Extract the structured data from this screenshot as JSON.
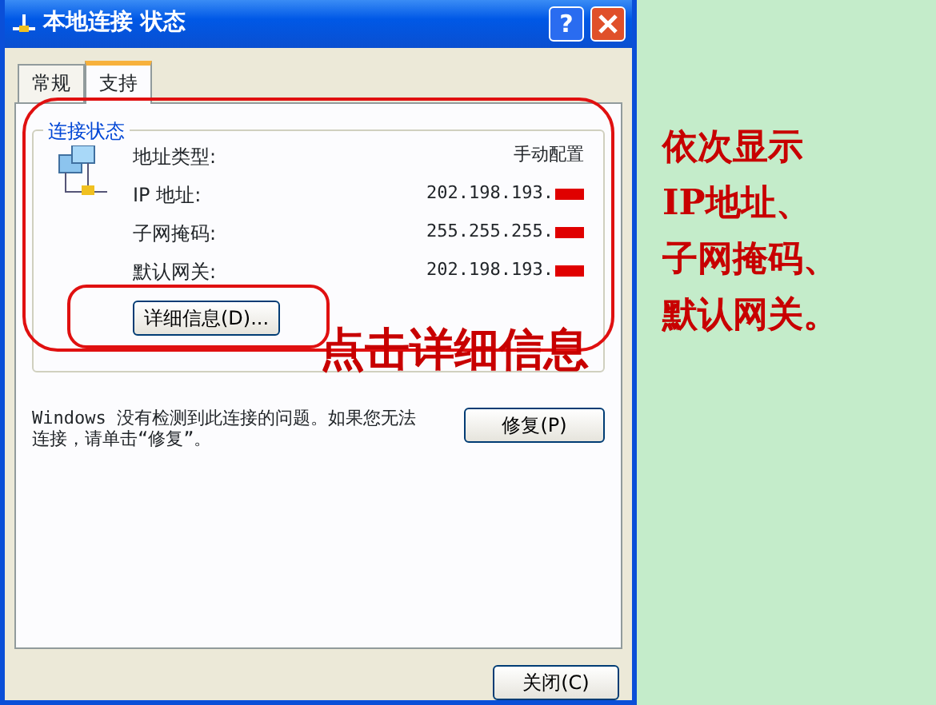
{
  "window": {
    "title": "本地连接 状态",
    "help_button": "?"
  },
  "tabs": [
    {
      "label": "常规",
      "selected": false
    },
    {
      "label": "支持",
      "selected": true
    }
  ],
  "connection_status": {
    "title": "连接状态",
    "rows": [
      {
        "label": "地址类型:",
        "value": "手动配置",
        "redacted": false
      },
      {
        "label": "IP 地址:",
        "value": "202.198.193.",
        "redacted": true
      },
      {
        "label": "子网掩码:",
        "value": "255.255.255.",
        "redacted": true
      },
      {
        "label": "默认网关:",
        "value": "202.198.193.",
        "redacted": true
      }
    ],
    "details_button": "详细信息(D)..."
  },
  "message": "Windows 没有检测到此连接的问题。如果您无法连接，请单击“修复”。",
  "repair_button": "修复(P)",
  "close_button": "关闭(C)",
  "annotations": {
    "callout": "点击详细信息",
    "side_note": [
      "依次显示",
      "IP地址、",
      "子网掩码、",
      "默认网关。"
    ]
  }
}
